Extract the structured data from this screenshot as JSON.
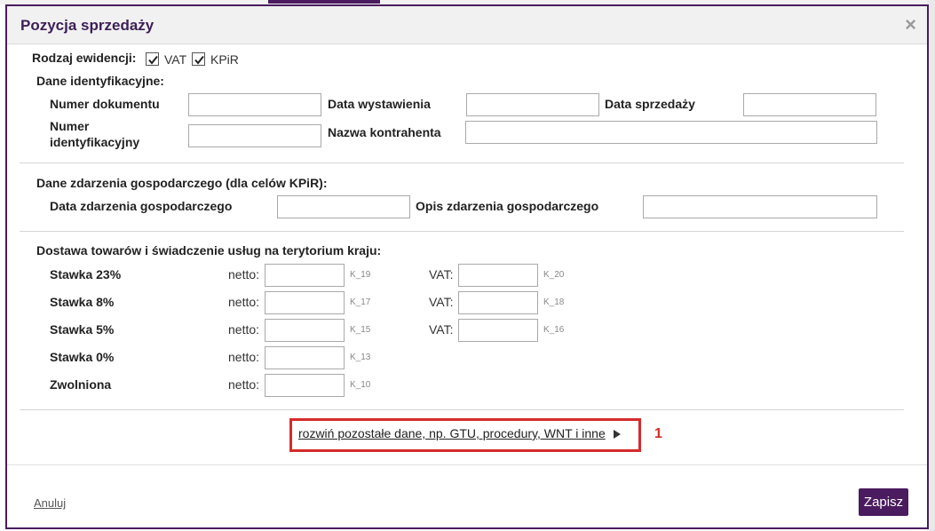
{
  "dialog": {
    "title": "Pozycja sprzedaży",
    "close_symbol": "×"
  },
  "record_type": {
    "label": "Rodzaj ewidencji:",
    "options": [
      {
        "label": "VAT",
        "checked": true
      },
      {
        "label": "KPiR",
        "checked": true
      }
    ]
  },
  "identification": {
    "heading": "Dane identyfikacyjne:",
    "document_number": {
      "label": "Numer dokumentu",
      "value": ""
    },
    "issue_date": {
      "label": "Data wystawienia",
      "value": ""
    },
    "sale_date": {
      "label": "Data sprzedaży",
      "value": ""
    },
    "id_number": {
      "label_line1": "Numer",
      "label_line2": "identyfikacyjny",
      "value": ""
    },
    "counterparty_name": {
      "label": "Nazwa kontrahenta",
      "value": ""
    }
  },
  "economic_event": {
    "heading": "Dane zdarzenia gospodarczego (dla celów KPiR):",
    "date": {
      "label": "Data zdarzenia gospodarczego",
      "value": ""
    },
    "description": {
      "label": "Opis zdarzenia gospodarczego",
      "value": ""
    }
  },
  "domestic_supply": {
    "heading": "Dostawa towarów i świadczenie usług na terytorium kraju:",
    "netto_label": "netto:",
    "vat_label": "VAT:",
    "rates": [
      {
        "label": "Stawka 23%",
        "netto_code": "K_19",
        "vat_code": "K_20"
      },
      {
        "label": "Stawka 8%",
        "netto_code": "K_17",
        "vat_code": "K_18"
      },
      {
        "label": "Stawka 5%",
        "netto_code": "K_15",
        "vat_code": "K_16"
      },
      {
        "label": "Stawka 0%",
        "netto_code": "K_13"
      },
      {
        "label": "Zwolniona",
        "netto_code": "K_10"
      }
    ]
  },
  "expand": {
    "label": "rozwiń pozostałe dane, np. GTU, procedury, WNT i inne",
    "annotation_number": "1"
  },
  "footer": {
    "cancel_label": "Anuluj",
    "save_label": "Zapisz"
  },
  "colors": {
    "accent": "#4a1b5e",
    "highlight": "#d52b2b"
  }
}
